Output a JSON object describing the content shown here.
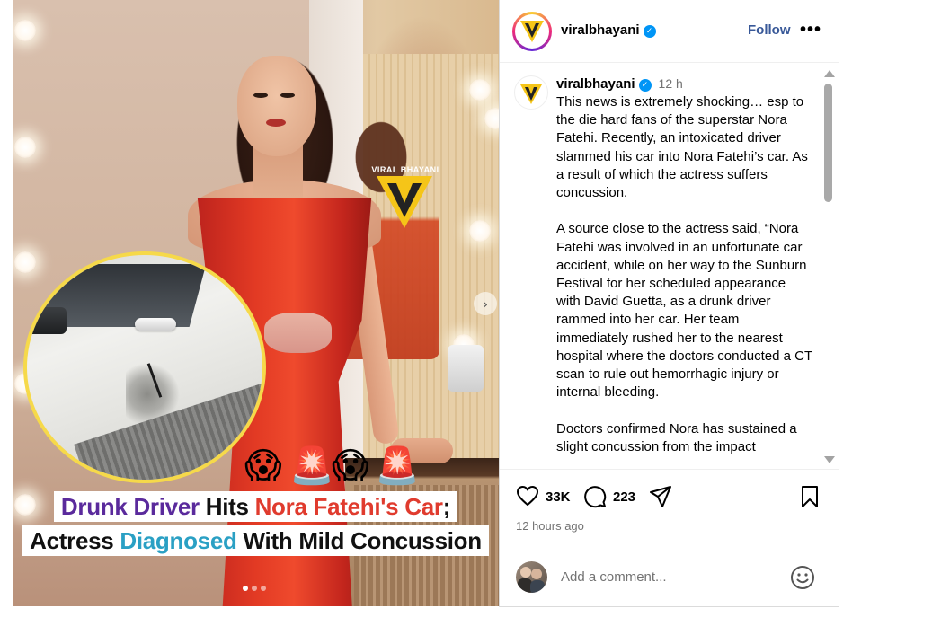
{
  "post": {
    "watermark": "VIRAL BHAYANI",
    "headline": {
      "line1": [
        {
          "text": "Drunk Driver",
          "color": "#5a2a9c"
        },
        {
          "text": " Hits ",
          "color": "#111111"
        },
        {
          "text": "Nora Fatehi's Car",
          "color": "#e03b2e"
        },
        {
          "text": ";",
          "color": "#111111"
        }
      ],
      "line2": [
        {
          "text": "Actress ",
          "color": "#111111"
        },
        {
          "text": "Diagnosed",
          "color": "#2aa0c4"
        },
        {
          "text": " With Mild Concussion",
          "color": "#111111"
        }
      ]
    },
    "emojis": [
      "😱",
      "🚨",
      "😱",
      "🚨"
    ],
    "carousel": {
      "current": 1,
      "total": 3
    }
  },
  "header": {
    "username": "viralbhayani",
    "verified": true,
    "follow_label": "Follow",
    "more_label": "•••"
  },
  "caption": {
    "username": "viralbhayani",
    "time": "12 h",
    "paragraphs": [
      "This news is extremely shocking… esp to the die hard fans of the superstar Nora Fatehi. Recently, an intoxicated driver slammed his car into Nora Fatehi’s car. As a result of which the actress suffers concussion.",
      "A source close to the actress said, “Nora Fatehi was involved in an unfortunate car accident, while on her way to the Sunburn Festival for her scheduled appearance with David Guetta, as a drunk driver rammed into her car. Her team immediately rushed her to the nearest hospital where the doctors  conducted a CT scan to rule out hemorrhagic injury or internal bleeding.",
      "Doctors confirmed Nora has sustained a slight concussion from the impact"
    ]
  },
  "actions": {
    "likes": "33K",
    "comments": "223",
    "timestamp": "12 hours ago"
  },
  "comment": {
    "placeholder": "Add a comment..."
  },
  "colors": {
    "accent": "#0095f6",
    "follow": "#385898",
    "logo_yellow": "#f5c518"
  },
  "icons": [
    "verified-badge-icon",
    "more-options-icon",
    "heart-icon",
    "comment-icon",
    "share-icon",
    "bookmark-icon",
    "emoji-icon",
    "chevron-right-icon"
  ]
}
